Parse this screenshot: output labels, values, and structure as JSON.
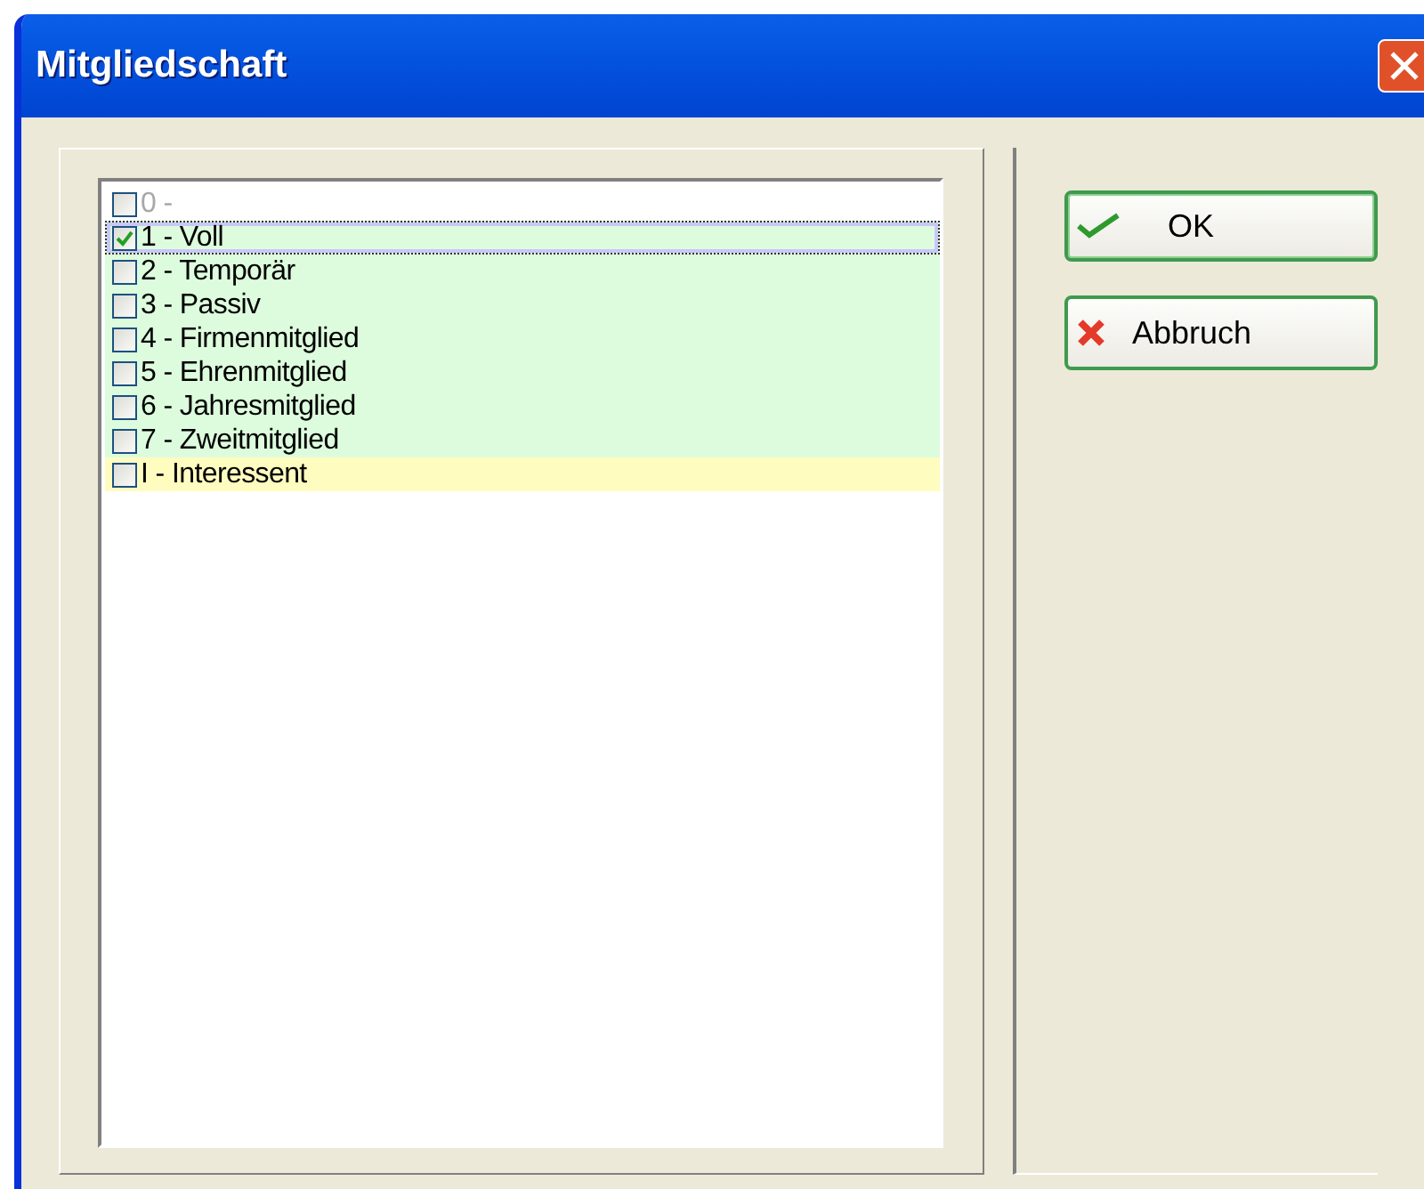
{
  "window": {
    "title": "Mitgliedschaft"
  },
  "items": [
    {
      "label": "0 -",
      "checked": false,
      "disabled": true,
      "selected": false,
      "color": "#ffffff"
    },
    {
      "label": "1 - Voll",
      "checked": true,
      "disabled": false,
      "selected": true,
      "color": "#ddfcdd"
    },
    {
      "label": "2 - Temporär",
      "checked": false,
      "disabled": false,
      "selected": false,
      "color": "#ddfcdd"
    },
    {
      "label": "3 - Passiv",
      "checked": false,
      "disabled": false,
      "selected": false,
      "color": "#ddfcdd"
    },
    {
      "label": "4 - Firmenmitglied",
      "checked": false,
      "disabled": false,
      "selected": false,
      "color": "#ddfcdd"
    },
    {
      "label": "5 - Ehrenmitglied",
      "checked": false,
      "disabled": false,
      "selected": false,
      "color": "#ddfcdd"
    },
    {
      "label": "6 - Jahresmitglied",
      "checked": false,
      "disabled": false,
      "selected": false,
      "color": "#ddfcdd"
    },
    {
      "label": "7 - Zweitmitglied",
      "checked": false,
      "disabled": false,
      "selected": false,
      "color": "#ddfcdd"
    },
    {
      "label": "I - Interessent",
      "checked": false,
      "disabled": false,
      "selected": false,
      "color": "#fffcc0"
    }
  ],
  "buttons": [
    {
      "kind": "ok",
      "label": "OK"
    },
    {
      "kind": "cancel",
      "label": "Abbruch"
    }
  ]
}
